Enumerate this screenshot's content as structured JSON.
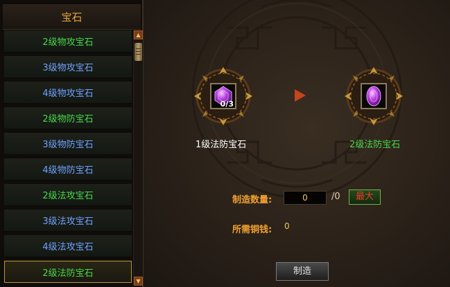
{
  "sidebar": {
    "title": "宝石",
    "items": [
      {
        "label": "2级物攻宝石",
        "color": "#47d94a"
      },
      {
        "label": "3级物攻宝石",
        "color": "#6fa0ff"
      },
      {
        "label": "4级物攻宝石",
        "color": "#6fa0ff"
      },
      {
        "label": "2级物防宝石",
        "color": "#47d94a"
      },
      {
        "label": "3级物防宝石",
        "color": "#6fa0ff"
      },
      {
        "label": "4级物防宝石",
        "color": "#6fa0ff"
      },
      {
        "label": "2级法攻宝石",
        "color": "#47d94a"
      },
      {
        "label": "3级法攻宝石",
        "color": "#6fa0ff"
      },
      {
        "label": "4级法攻宝石",
        "color": "#6fa0ff"
      },
      {
        "label": "2级法防宝石",
        "color": "#47d94a",
        "selected": true
      }
    ],
    "scroll_up_icon": "triangle-up-icon",
    "scroll_down_icon": "triangle-down-icon"
  },
  "synthesis": {
    "source": {
      "name": "1级法防宝石",
      "count": "0/3",
      "name_color": "#ffffff"
    },
    "target": {
      "name": "2级法防宝石",
      "name_color": "#47d94a"
    },
    "arrow_icon": "arrow-right-icon"
  },
  "craft": {
    "quantity_label": "制造数量:",
    "quantity_value": "0",
    "quantity_max_suffix": "/0",
    "max_label": "最大",
    "copper_label": "所需铜钱:",
    "copper_value": "0",
    "make_label": "制造"
  },
  "colors": {
    "accent_orange": "#f0a030",
    "green_quality": "#47d94a",
    "blue_quality": "#6fa0ff",
    "max_text": "#e83b2a"
  }
}
